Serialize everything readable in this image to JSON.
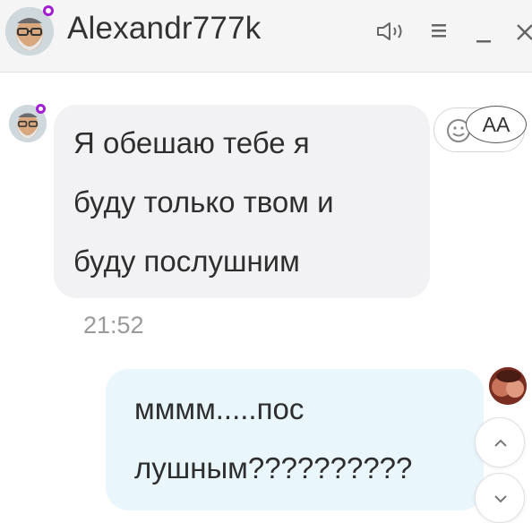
{
  "header": {
    "title": "Alexandr777k",
    "icons": [
      "speaker-icon",
      "menu-icon",
      "minimize-icon",
      "close-icon"
    ]
  },
  "messages": [
    {
      "direction": "incoming",
      "lines": [
        "Я обешаю тебе я",
        "буду только твом и",
        "буду послушним"
      ],
      "time": "21:52"
    },
    {
      "direction": "outgoing",
      "lines": [
        "мммм.....пос",
        "лушным??????????"
      ]
    }
  ],
  "reaction": {
    "badge_label": "AA"
  },
  "colors": {
    "status_ring": "#a11fd0",
    "incoming_bubble": "#f2f2f4",
    "outgoing_bubble": "#e9f6fc",
    "header_bg": "#f5f5f6"
  }
}
